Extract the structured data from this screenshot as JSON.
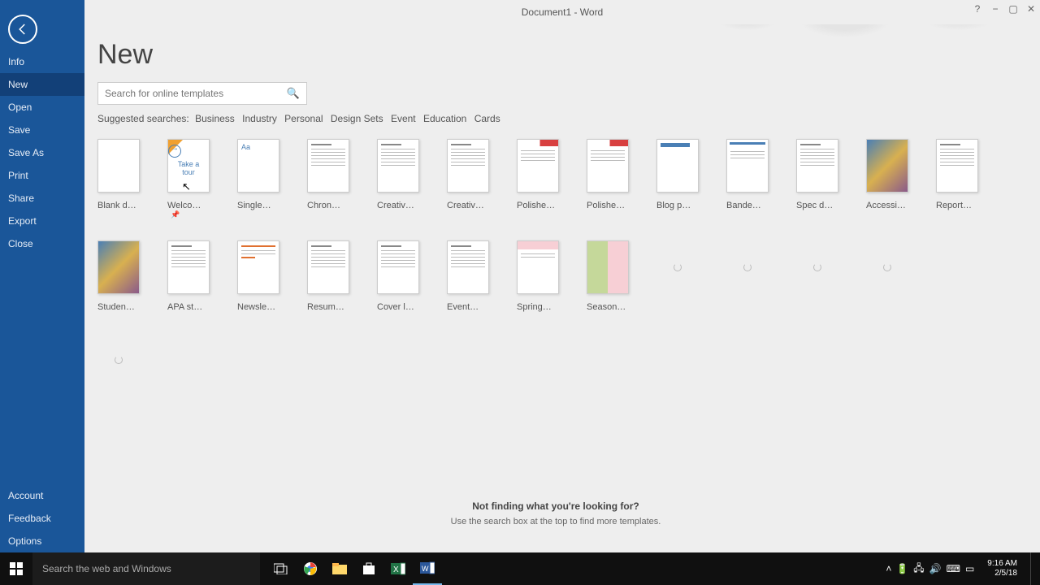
{
  "titlebar": {
    "title": "Document1  -  Word"
  },
  "winctrl": {
    "help": "?",
    "min": "−",
    "max": "▢",
    "close": "✕"
  },
  "sidebar": {
    "items": [
      "Info",
      "New",
      "Open",
      "Save",
      "Save As",
      "Print",
      "Share",
      "Export",
      "Close"
    ],
    "bottom": [
      "Account",
      "Feedback",
      "Options"
    ],
    "active_index": 1
  },
  "page": {
    "title": "New",
    "search_placeholder": "Search for online templates",
    "suggested_label": "Suggested searches:",
    "suggested": [
      "Business",
      "Industry",
      "Personal",
      "Design Sets",
      "Event",
      "Education",
      "Cards"
    ],
    "notfound_title": "Not finding what you're looking for?",
    "notfound_sub": "Use the search box at the top to find more templates."
  },
  "templates_row1": [
    {
      "label": "Blank do…",
      "kind": "blank"
    },
    {
      "label": "Welco…",
      "kind": "tour",
      "tour_line1": "Take a",
      "tour_line2": "tour",
      "pin": "📌"
    },
    {
      "label": "Single…",
      "kind": "aa"
    },
    {
      "label": "Chron…",
      "kind": "doclines"
    },
    {
      "label": "Creativ…",
      "kind": "doclines"
    },
    {
      "label": "Creativ…",
      "kind": "doclines"
    },
    {
      "label": "Polishe…",
      "kind": "redtop"
    },
    {
      "label": "Polishe…",
      "kind": "redtop"
    },
    {
      "label": "Blog p…",
      "kind": "titlestrip"
    },
    {
      "label": "Bande…",
      "kind": "band"
    },
    {
      "label": "Spec d…",
      "kind": "doclines"
    },
    {
      "label": "Accessi…",
      "kind": "img"
    },
    {
      "label": "Report…",
      "kind": "doclines"
    }
  ],
  "templates_row2": [
    {
      "label": "Studen…",
      "kind": "img"
    },
    {
      "label": "APA st…",
      "kind": "doclines"
    },
    {
      "label": "Newsle…",
      "kind": "news"
    },
    {
      "label": "Resum…",
      "kind": "doclines"
    },
    {
      "label": "Cover l…",
      "kind": "doclines"
    },
    {
      "label": "Event…",
      "kind": "doclines"
    },
    {
      "label": "Spring…",
      "kind": "spring"
    },
    {
      "label": "Season…",
      "kind": "season"
    },
    {
      "label": "",
      "kind": "loading"
    },
    {
      "label": "",
      "kind": "loading"
    },
    {
      "label": "",
      "kind": "loading"
    },
    {
      "label": "",
      "kind": "loading"
    }
  ],
  "templates_row3": [
    {
      "label": "",
      "kind": "loading"
    }
  ],
  "taskbar": {
    "search_placeholder": "Search the web and Windows",
    "time": "9:16 AM",
    "date": "2/5/18"
  }
}
